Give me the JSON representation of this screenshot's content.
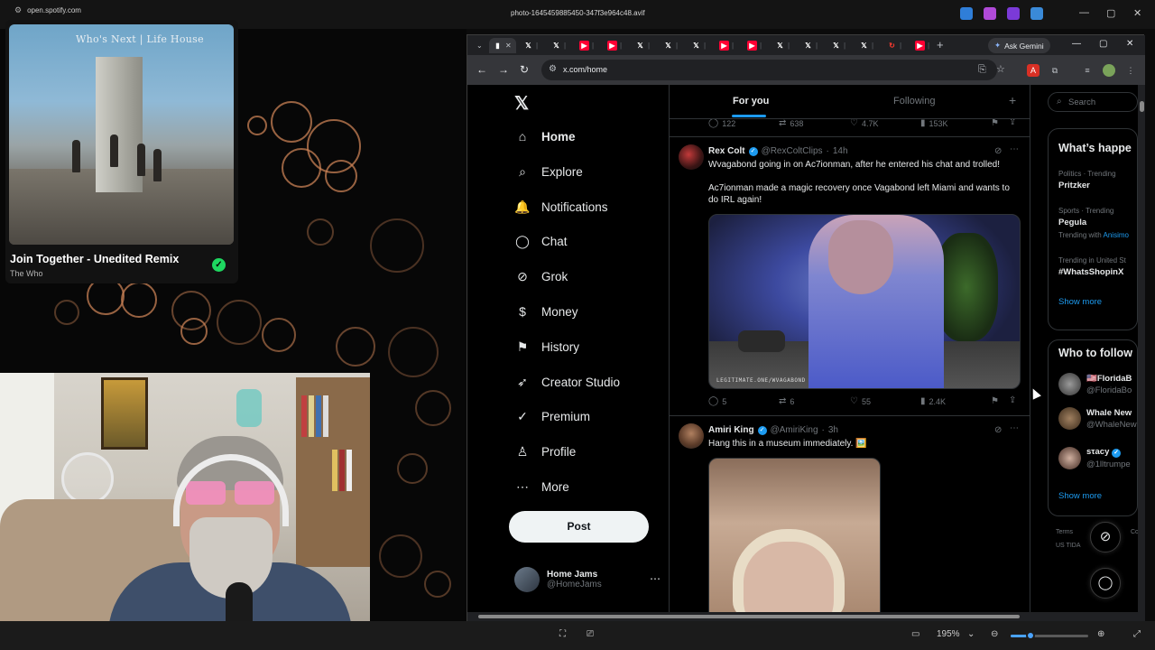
{
  "viewer": {
    "file_name": "photo-1645459885450-347f3e964c48.avif",
    "zoom_level": "195%",
    "zoom_fraction": 0.25,
    "window_controls": [
      "—",
      "▢",
      "✕"
    ]
  },
  "spotify": {
    "url": "open.spotify.com",
    "album_cover_text": "Who's Next | Life House",
    "track_title": "Join Together - Unedited Remix",
    "artist": "The Who",
    "liked_icon": "check-circle-icon",
    "liked_color": "#1ed760"
  },
  "browser": {
    "ask_gemini": "Ask Gemini",
    "url": "x.com/home",
    "new_tab_symbol": "+",
    "tabs": [
      {
        "icon": "x",
        "color": "#ffffff"
      },
      {
        "icon": "x",
        "color": "#ffffff"
      },
      {
        "icon": "youtube",
        "color": "#ff0033"
      },
      {
        "icon": "youtube",
        "color": "#ff0033"
      },
      {
        "icon": "x",
        "color": "#ffffff"
      },
      {
        "icon": "x",
        "color": "#ffffff"
      },
      {
        "icon": "x",
        "color": "#ffffff"
      },
      {
        "icon": "youtube",
        "color": "#ff0033"
      },
      {
        "icon": "youtube",
        "color": "#ff0033"
      },
      {
        "icon": "x",
        "color": "#ffffff"
      },
      {
        "icon": "x",
        "color": "#ffffff"
      },
      {
        "icon": "x",
        "color": "#ffffff"
      },
      {
        "icon": "x",
        "color": "#ffffff"
      },
      {
        "icon": "reload",
        "color": "#ff3b30"
      },
      {
        "icon": "youtube",
        "color": "#ff0033"
      }
    ]
  },
  "x": {
    "nav": [
      {
        "label": "Home",
        "icon": "home-icon",
        "glyph": "⌂"
      },
      {
        "label": "Explore",
        "icon": "search-icon",
        "glyph": "⌕"
      },
      {
        "label": "Notifications",
        "icon": "bell-icon",
        "glyph": "🔔"
      },
      {
        "label": "Chat",
        "icon": "chat-icon",
        "glyph": "◯"
      },
      {
        "label": "Grok",
        "icon": "grok-icon",
        "glyph": "⊘"
      },
      {
        "label": "Money",
        "icon": "money-icon",
        "glyph": "$"
      },
      {
        "label": "History",
        "icon": "bookmark-icon",
        "glyph": "⚑"
      },
      {
        "label": "Creator Studio",
        "icon": "rocket-icon",
        "glyph": "➶"
      },
      {
        "label": "Premium",
        "icon": "premium-icon",
        "glyph": "✓"
      },
      {
        "label": "Profile",
        "icon": "person-icon",
        "glyph": "♙"
      },
      {
        "label": "More",
        "icon": "more-icon",
        "glyph": "⋯"
      }
    ],
    "post_button": "Post",
    "account": {
      "name": "Home Jams",
      "handle": "@HomeJams"
    },
    "tabs": {
      "for_you": "For you",
      "following": "Following"
    },
    "prev_tweet_stats": {
      "replies": "122",
      "reposts": "638",
      "likes": "4.7K",
      "views": "153K"
    },
    "tweets": [
      {
        "name": "Rex Colt",
        "handle": "@RexColtClips",
        "time": "14h",
        "text": "Wvagabond going in on Ac7ionman, after he entered his chat and trolled!",
        "text2": "Ac7ionman made a magic recovery once Vagabond left Miami and wants to do IRL again!",
        "watermark": "LEGITIMATE.ONE/WVAGABOND",
        "stats": {
          "replies": "5",
          "reposts": "6",
          "likes": "55",
          "views": "2.4K"
        }
      },
      {
        "name": "Amiri King",
        "handle": "@AmiriKing",
        "time": "3h",
        "text": "Hang this in a museum immediately. 🖼️"
      }
    ],
    "search_placeholder": "Search",
    "trends": {
      "title": "What’s happe",
      "items": [
        {
          "category": "Politics · Trending",
          "name": "Pritzker",
          "with": ""
        },
        {
          "category": "Sports · Trending",
          "name": "Pegula",
          "with_label": "Trending with",
          "with": "Anisimo"
        },
        {
          "category": "Trending in United St",
          "name": "#WhatsShopinX",
          "with": ""
        }
      ],
      "show_more": "Show more"
    },
    "who_to_follow": {
      "title": "Who to follow",
      "items": [
        {
          "name": "🇺🇸FloridaB",
          "handle": "@FloridaBo"
        },
        {
          "name": "Whale New",
          "handle": "@WhaleNew"
        },
        {
          "name": "sτacy",
          "handle": "@1lltrumpe"
        }
      ],
      "show_more": "Show more"
    },
    "footer": {
      "terms": "Terms",
      "co": "Co",
      "ustida": "US TIDA"
    }
  }
}
